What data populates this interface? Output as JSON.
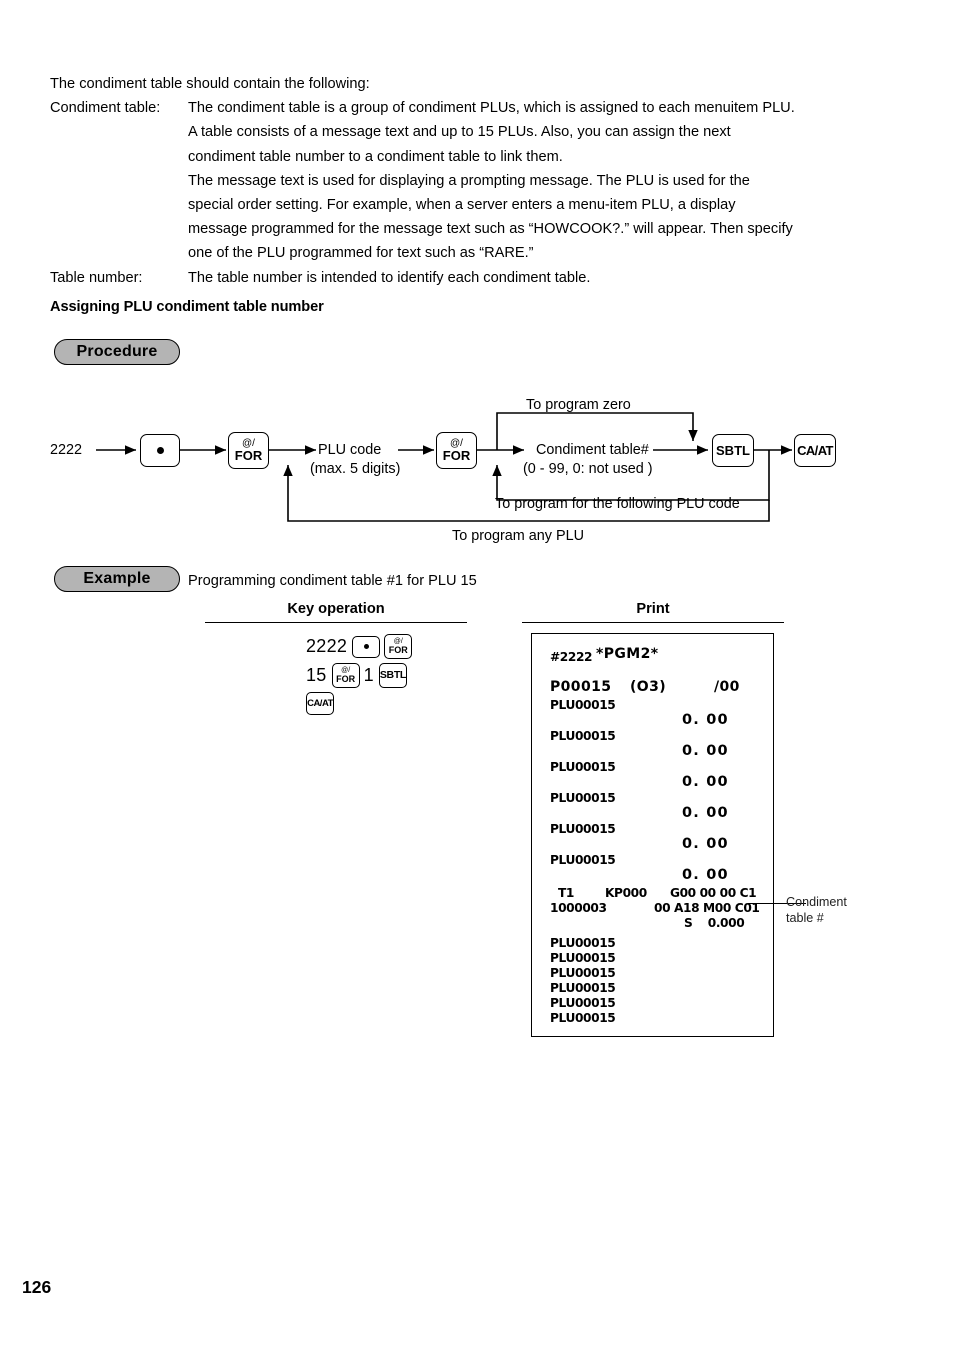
{
  "intro": {
    "lead": "The condiment table should contain the following:",
    "rows": [
      {
        "label": "Condiment table:",
        "lines": [
          "The condiment table is a group of condiment PLUs, which is assigned to each menuitem PLU.",
          "A table consists of a message text and up to 15 PLUs. Also, you can assign the next",
          "condiment table number to a condiment table to link them.",
          "The message text is used for displaying a prompting message. The PLU is used for the",
          "special order setting. For example, when a server enters a menu-item PLU, a display",
          "message programmed for the message text such as “HOWCOOK?.” will appear. Then specify",
          "one of the PLU programmed for text such as “RARE.”"
        ]
      },
      {
        "label": "Table number:",
        "lines": [
          "The table number is intended to identify each condiment table."
        ]
      }
    ]
  },
  "section": {
    "heading": "Assigning PLU condiment table number"
  },
  "badges": {
    "procedure": "Procedure",
    "example": "Example"
  },
  "flow": {
    "start_value": "2222",
    "keys": {
      "point_top": "",
      "for_top": "@/",
      "for_bottom": "FOR",
      "sbtl": "SBTL",
      "caat": "CA/AT"
    },
    "plu_code_line1": "PLU code",
    "plu_code_line2": "(max. 5 digits)",
    "condiment_line1": "Condiment table#",
    "condiment_line2": "(0 - 99, 0: not used  )",
    "label_program_zero": "To program zero",
    "label_following_plu": "To program for the following PLU code",
    "label_any_plu": "To program any PLU"
  },
  "example": {
    "caption": "Programming condiment table #1 for PLU 15",
    "columns": {
      "key_operation": "Key operation",
      "print": "Print"
    },
    "key_operation": {
      "row1_number": "2222",
      "row2_number": "15",
      "row2_number2": "1",
      "key_for_top": "@/",
      "key_for_bottom": "FOR",
      "key_sbtl": "SBTL",
      "key_caat": "CA/AT"
    }
  },
  "receipt": {
    "header": {
      "code": "#2222",
      "mode": "*PGM2*"
    },
    "plu_header": {
      "p_code": "P00015",
      "group": "(O3)",
      "suffix": "/00"
    },
    "plu_rows": [
      {
        "label": "PLU00015",
        "amount": "0. 00"
      },
      {
        "label": "PLU00015",
        "amount": "0. 00"
      },
      {
        "label": "PLU00015",
        "amount": "0. 00"
      },
      {
        "label": "PLU00015",
        "amount": "0. 00"
      },
      {
        "label": "PLU00015",
        "amount": "0. 00"
      },
      {
        "label": "PLU00015",
        "amount": "0. 00"
      }
    ],
    "status": {
      "line1_left": "T1",
      "line1_mid": "KP000",
      "line1_right": "G00 00 00 C1",
      "line2_left": "1000003",
      "line2_right": "00 A18 M00 C01",
      "line3_right": "S    0.000"
    },
    "plu_tail": [
      "PLU00015",
      "PLU00015",
      "PLU00015",
      "PLU00015",
      "PLU00015",
      "PLU00015"
    ]
  },
  "callout": {
    "line1": "Condiment",
    "line2": "table #"
  },
  "page": {
    "number": "126"
  }
}
